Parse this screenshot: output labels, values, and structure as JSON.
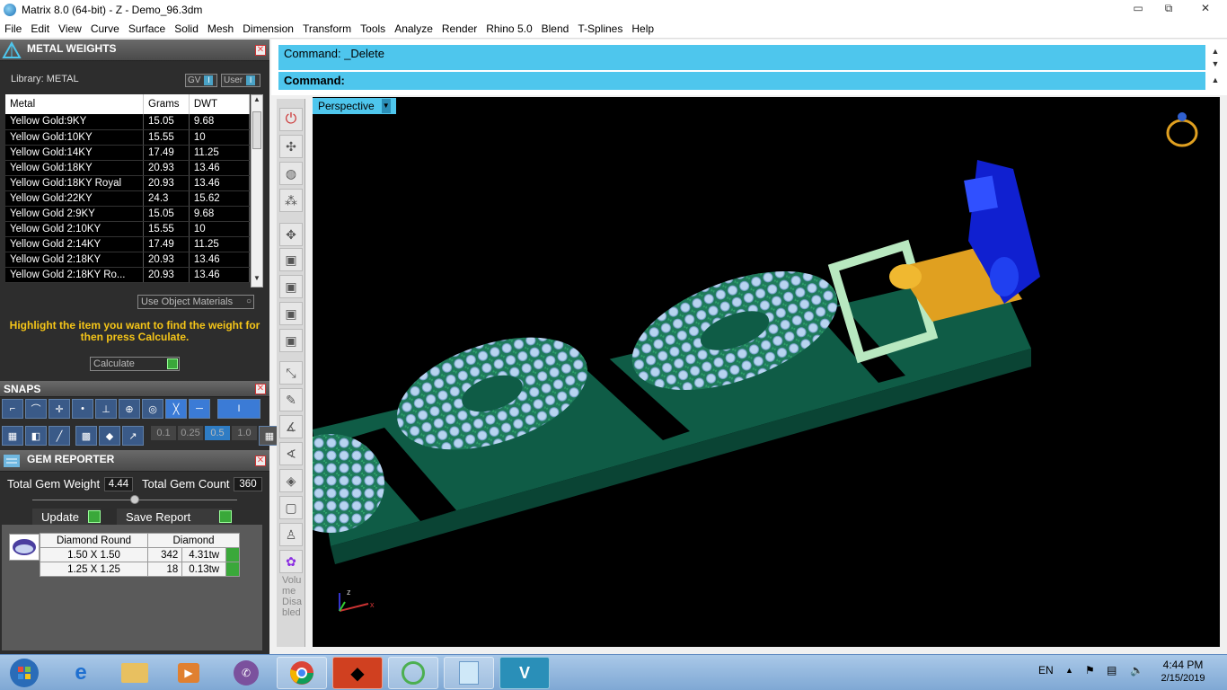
{
  "window": {
    "title": "Matrix 8.0 (64-bit) - Z - Demo_96.3dm",
    "min": "▭",
    "max": "⧉",
    "close": "✕"
  },
  "menu": [
    "File",
    "Edit",
    "View",
    "Curve",
    "Surface",
    "Solid",
    "Mesh",
    "Dimension",
    "Transform",
    "Tools",
    "Analyze",
    "Render",
    "Rhino 5.0",
    "Blend",
    "T-Splines",
    "Help"
  ],
  "metal_weights": {
    "title": "METAL WEIGHTS",
    "library": "Library: METAL",
    "gv": "GV",
    "user": "User",
    "columns": [
      "Metal",
      "Grams",
      "DWT"
    ],
    "rows": [
      [
        "Yellow Gold:9KY",
        "15.05",
        "9.68"
      ],
      [
        "Yellow Gold:10KY",
        "15.55",
        "10"
      ],
      [
        "Yellow Gold:14KY",
        "17.49",
        "11.25"
      ],
      [
        "Yellow Gold:18KY",
        "20.93",
        "13.46"
      ],
      [
        "Yellow Gold:18KY Royal",
        "20.93",
        "13.46"
      ],
      [
        "Yellow Gold:22KY",
        "24.3",
        "15.62"
      ],
      [
        "Yellow Gold 2:9KY",
        "15.05",
        "9.68"
      ],
      [
        "Yellow Gold 2:10KY",
        "15.55",
        "10"
      ],
      [
        "Yellow Gold 2:14KY",
        "17.49",
        "11.25"
      ],
      [
        "Yellow Gold 2:18KY",
        "20.93",
        "13.46"
      ],
      [
        "Yellow Gold 2:18KY Ro...",
        "20.93",
        "13.46"
      ]
    ],
    "use_object_materials": "Use Object Materials",
    "hint": "Highlight the item you want to find the weight for then press Calculate.",
    "calculate": "Calculate"
  },
  "snaps": {
    "title": "SNAPS",
    "tolerances": [
      "0.1",
      "0.25",
      "0.5",
      "1.0"
    ],
    "selected_tolerance": "0.5"
  },
  "gem_reporter": {
    "title": "GEM REPORTER",
    "total_weight_label": "Total Gem Weight",
    "total_weight": "4.44",
    "total_count_label": "Total Gem Count",
    "total_count": "360",
    "update": "Update",
    "save_report": "Save Report",
    "columns": [
      "Diamond Round",
      "Diamond"
    ],
    "rows": [
      [
        "1.50 X 1.50",
        "342",
        "4.31tw"
      ],
      [
        "1.25 X 1.25",
        "18",
        "0.13tw"
      ]
    ]
  },
  "command": {
    "history": "Command: _Delete",
    "prompt": "Command:"
  },
  "viewport": {
    "label": "Perspective",
    "axis_z": "z",
    "axis_x": "x"
  },
  "vertical_toolbar": {
    "disabled_text": "Volume Disabled"
  },
  "taskbar": {
    "lang": "EN",
    "time": "4:44 PM",
    "date": "2/15/2019"
  }
}
